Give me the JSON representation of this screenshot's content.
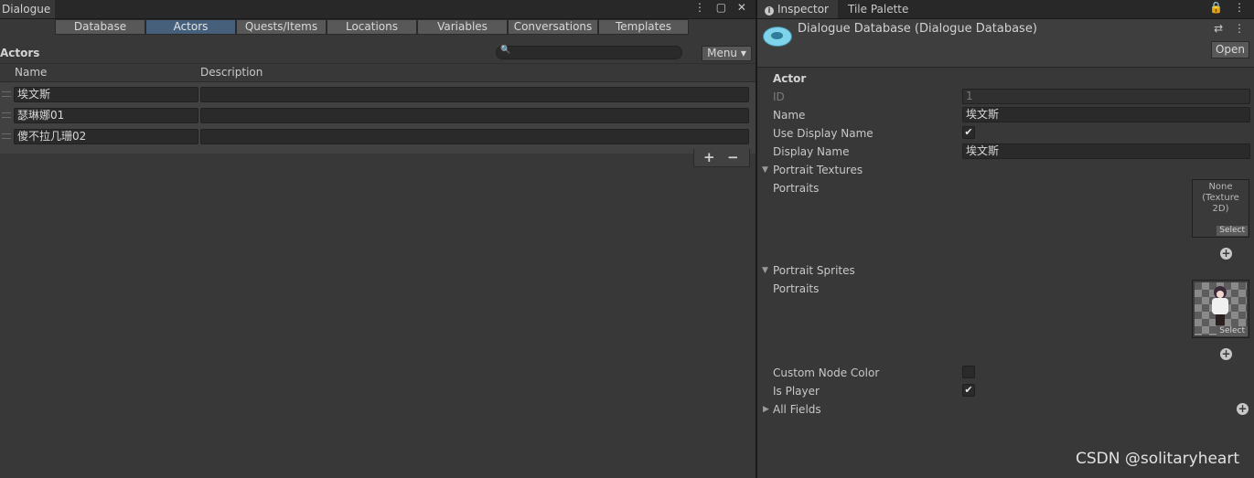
{
  "left_window": {
    "tab_title": "Dialogue",
    "tools": "⋮ ▢ ✕",
    "toolbar_tabs": [
      {
        "label": "Database"
      },
      {
        "label": "Actors"
      },
      {
        "label": "Quests/Items"
      },
      {
        "label": "Locations"
      },
      {
        "label": "Variables"
      },
      {
        "label": "Conversations"
      },
      {
        "label": "Templates"
      }
    ],
    "active_tab": "Actors",
    "section_title": "Actors",
    "search": {
      "value": "",
      "placeholder": ""
    },
    "menu_label": "Menu ▾",
    "columns": {
      "name": "Name",
      "description": "Description"
    },
    "rows": [
      {
        "name": "埃文斯",
        "description": ""
      },
      {
        "name": "瑟琳娜01",
        "description": ""
      },
      {
        "name": "傻不拉几珊02",
        "description": ""
      }
    ],
    "add_label": "+",
    "remove_label": "−"
  },
  "inspector": {
    "tab_label": "Inspector",
    "tab_info_glyph": "i",
    "second_tab_label": "Tile Palette",
    "tools": "🔒 ⋮",
    "asset_title": "Dialogue Database (Dialogue Database)",
    "header_icons": "⇄ ⋮",
    "open_label": "Open",
    "section_title": "Actor",
    "fields": {
      "id_label": "ID",
      "id_value": "1",
      "name_label": "Name",
      "name_value": "埃文斯",
      "use_display_name_label": "Use Display Name",
      "use_display_name_checked": true,
      "display_name_label": "Display Name",
      "display_name_value": "埃文斯",
      "portrait_textures_label": "Portrait Textures",
      "portraits_label_1": "Portraits",
      "texture_slot_text": "None (Texture 2D)",
      "select_label": "Select",
      "portrait_sprites_label": "Portrait Sprites",
      "portraits_label_2": "Portraits",
      "custom_node_color_label": "Custom Node Color",
      "custom_node_color_checked": false,
      "is_player_label": "Is Player",
      "is_player_checked": true,
      "all_fields_label": "All Fields"
    }
  },
  "watermark": "CSDN @solitaryheart",
  "colors": {
    "background": "#383838",
    "active_tab": "#46607c",
    "field_bg": "#2a2a2a",
    "accent_icon": "#7fd3ea"
  },
  "icons": [
    "search-icon",
    "kebab-menu-icon",
    "maximize-icon",
    "close-icon",
    "info-icon",
    "lock-icon",
    "dialogue-bubble-icon",
    "add-circle-icon",
    "foldout-arrow-icon",
    "drag-handle-icon",
    "checkmark-icon"
  ]
}
